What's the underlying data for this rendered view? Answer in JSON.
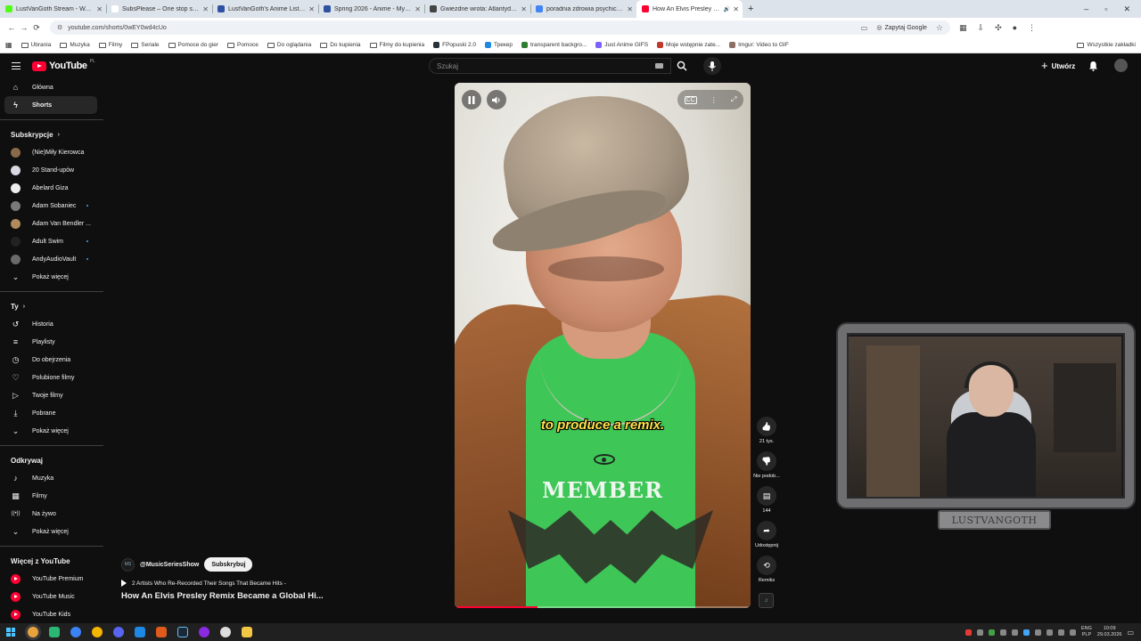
{
  "browser": {
    "tabs": [
      {
        "title": "LustVanGoth Stream - Watch L",
        "color": "#53fc18"
      },
      {
        "title": "SubsPlease – One stop shop fo",
        "color": "#ffffff"
      },
      {
        "title": "LustVanGoth's Anime List - My",
        "color": "#2e51a2"
      },
      {
        "title": "Spring 2026 - Anime - MyAnim",
        "color": "#2e51a2"
      },
      {
        "title": "Gwiezdne wrota: Atlantyda / St",
        "color": "#444444"
      },
      {
        "title": "poradnia zdrowia psychicznego",
        "color": "#4285f4"
      },
      {
        "title": "How An Elvis Presley Remix",
        "color": "#ff0033"
      }
    ],
    "url": "youtube.com/shorts/0wEY0wd4cUo",
    "google_button": "Zapytaj Google",
    "bookmarks": [
      {
        "label": "Ubrania",
        "type": "folder"
      },
      {
        "label": "Muzyka",
        "type": "folder"
      },
      {
        "label": "Filmy",
        "type": "folder"
      },
      {
        "label": "Seriale",
        "type": "folder"
      },
      {
        "label": "Pomoce do gier",
        "type": "folder"
      },
      {
        "label": "Pomoce",
        "type": "folder"
      },
      {
        "label": "Do oglądania",
        "type": "folder"
      },
      {
        "label": "Do kupienia",
        "type": "folder"
      },
      {
        "label": "Filmy do kupienia",
        "type": "folder"
      },
      {
        "label": "FPopuski 2.0",
        "type": "site"
      },
      {
        "label": "Трекер",
        "type": "site"
      },
      {
        "label": "transparent backgro...",
        "type": "site"
      },
      {
        "label": "Just Anime GIFS",
        "type": "site"
      },
      {
        "label": "Moje wstępnie zate...",
        "type": "site"
      },
      {
        "label": "Imgur: Video to GIF",
        "type": "site"
      }
    ],
    "all_bookmarks": "Wszystkie zakładki"
  },
  "youtube": {
    "logo": "YouTube",
    "country": "PL",
    "search_placeholder": "Szukaj",
    "create_label": "Utwórz",
    "sidebar": {
      "main": [
        {
          "label": "Główna",
          "icon": "home-icon"
        },
        {
          "label": "Shorts",
          "icon": "shorts-icon",
          "active": true
        }
      ],
      "subs_header": "Subskrypcje",
      "subscriptions": [
        {
          "label": "(Nie)Miły Kierowca",
          "color": "#8a6a4a",
          "dot": false
        },
        {
          "label": "20 Stand-upów",
          "color": "#d9d9e3",
          "dot": false
        },
        {
          "label": "Abelard Giza",
          "color": "#eeeeee",
          "dot": false
        },
        {
          "label": "Adam Sobaniec",
          "color": "#7a7a7a",
          "dot": true
        },
        {
          "label": "Adam Van Bendler ...",
          "color": "#b08a5a",
          "dot": false
        },
        {
          "label": "Adult Swim",
          "color": "#222222",
          "dot": true
        },
        {
          "label": "AndyAudioVault",
          "color": "#6a6a6a",
          "dot": true
        }
      ],
      "show_more": "Pokaż więcej",
      "you_header": "Ty",
      "you": [
        {
          "label": "Historia",
          "icon": "history-icon"
        },
        {
          "label": "Playlisty",
          "icon": "playlists-icon"
        },
        {
          "label": "Do obejrzenia",
          "icon": "watch-later-icon"
        },
        {
          "label": "Polubione filmy",
          "icon": "liked-icon"
        },
        {
          "label": "Twoje filmy",
          "icon": "your-videos-icon"
        },
        {
          "label": "Pobrane",
          "icon": "downloads-icon"
        },
        {
          "label": "Pokaż więcej",
          "icon": "chevron-down-icon"
        }
      ],
      "explore_header": "Odkrywaj",
      "explore": [
        {
          "label": "Muzyka",
          "icon": "music-icon"
        },
        {
          "label": "Filmy",
          "icon": "films-icon"
        },
        {
          "label": "Na żywo",
          "icon": "live-icon"
        },
        {
          "label": "Pokaż więcej",
          "icon": "chevron-down-icon"
        }
      ],
      "more_header": "Więcej z YouTube",
      "more": [
        {
          "label": "YouTube Premium"
        },
        {
          "label": "YouTube Music"
        },
        {
          "label": "YouTube Kids"
        }
      ]
    },
    "short": {
      "caption": "to produce a remix.",
      "shirt_text": "MEMBER",
      "progress": 0.28,
      "channel": "@MusicSeriesShow",
      "subscribe": "Subskrybuj",
      "playlist": "2 Artists Who Re-Recorded Their Songs That Became Hits -",
      "title": "How An Elvis Presley Remix Became a Global Hi...",
      "actions": [
        {
          "name": "like",
          "label": "21 tys.",
          "icon": "thumbs-up-icon"
        },
        {
          "name": "dislike",
          "label": "Nie podob...",
          "icon": "thumbs-down-icon"
        },
        {
          "name": "comments",
          "label": "144",
          "icon": "comment-icon"
        },
        {
          "name": "share",
          "label": "Udostępnij",
          "icon": "share-icon"
        },
        {
          "name": "remix",
          "label": "Remiks",
          "icon": "remix-icon"
        }
      ]
    }
  },
  "overlay": {
    "cam_label": "LUSTVANGOTH"
  },
  "taskbar": {
    "lang_top": "ENG",
    "lang_bottom": "PLP",
    "time": "10:09",
    "date": "29.03.2026"
  }
}
